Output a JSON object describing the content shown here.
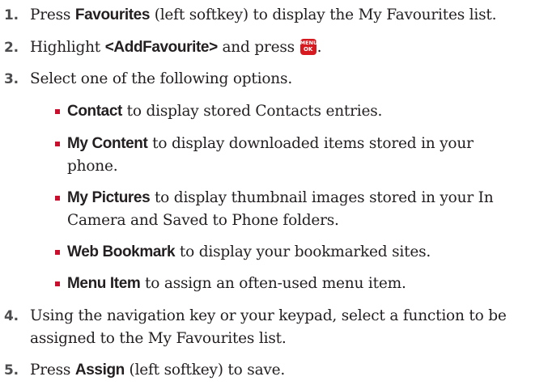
{
  "steps": [
    {
      "number": "1.",
      "pre": "Press ",
      "keyword": "Favourites",
      "post": " (left softkey) to display the My Favourites list."
    },
    {
      "number": "2.",
      "pre": "Highlight ",
      "keyword": "<AddFavourite>",
      "mid": " and press ",
      "icon_top": "MENU",
      "icon_bottom": "OK",
      "post": "."
    },
    {
      "number": "3.",
      "text": "Select one of the following options."
    },
    {
      "number": "4.",
      "line1": "Using the navigation key or your keypad, select a function to be",
      "line2": "assigned to the My Favourites list."
    },
    {
      "number": "5.",
      "pre": "Press ",
      "keyword": "Assign",
      "post": " (left softkey) to save."
    }
  ],
  "options": [
    {
      "keyword": "Contact",
      "text": " to display stored Contacts entries."
    },
    {
      "keyword": "My Content",
      "text": " to display downloaded items stored in your",
      "text2": "phone."
    },
    {
      "keyword": "My Pictures",
      "text": " to display thumbnail images stored in your In",
      "text2": "Camera and Saved to Phone folders."
    },
    {
      "keyword": "Web Bookmark",
      "text": " to display your bookmarked sites."
    },
    {
      "keyword": "Menu Item",
      "text": " to assign an often-used menu item."
    }
  ],
  "colors": {
    "text": "#231f20",
    "step_number": "#4d4d4f",
    "bullet": "#c8102e",
    "menu_key": "#d71920"
  },
  "icons": {
    "menu_ok_key": "menu-ok-key-icon"
  }
}
